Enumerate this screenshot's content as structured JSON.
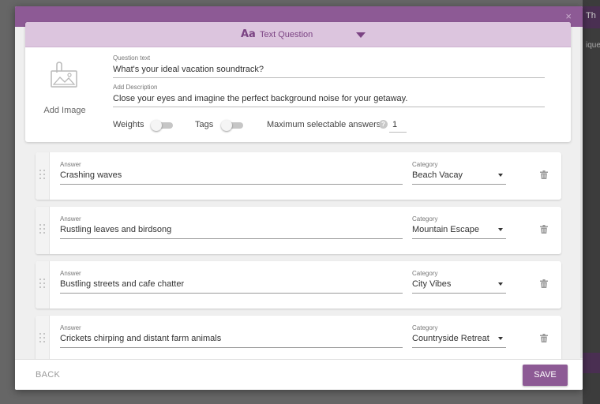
{
  "background": {
    "strip_text_top": "Th",
    "strip_text_mid": "ique"
  },
  "modal": {
    "close_glyph": "×",
    "question_type": {
      "icon_text": "Aa",
      "label": "Text Question"
    },
    "add_image_label": "Add Image",
    "question_text": {
      "label": "Question text",
      "value": "What's your ideal vacation soundtrack?"
    },
    "description": {
      "label": "Add Description",
      "value": "Close your eyes and imagine the perfect background noise for your getaway."
    },
    "options": {
      "weights_label": "Weights",
      "weights_on": false,
      "tags_label": "Tags",
      "tags_on": false,
      "max_answers_label": "Maximum selectable answers",
      "max_answers_value": "1",
      "help_glyph": "?"
    },
    "answers": [
      {
        "answer_label": "Answer",
        "answer": "Crashing waves",
        "category_label": "Category",
        "category": "Beach Vacay"
      },
      {
        "answer_label": "Answer",
        "answer": "Rustling leaves and birdsong",
        "category_label": "Category",
        "category": "Mountain Escape"
      },
      {
        "answer_label": "Answer",
        "answer": "Bustling streets and cafe chatter",
        "category_label": "Category",
        "category": "City Vibes"
      },
      {
        "answer_label": "Answer",
        "answer": "Crickets chirping and distant farm animals",
        "category_label": "Category",
        "category": "Countryside Retreat"
      }
    ],
    "footer": {
      "back_label": "BACK",
      "save_label": "SAVE"
    },
    "colors": {
      "accent": "#8d5a95",
      "type_bar": "#dcc5de"
    }
  }
}
